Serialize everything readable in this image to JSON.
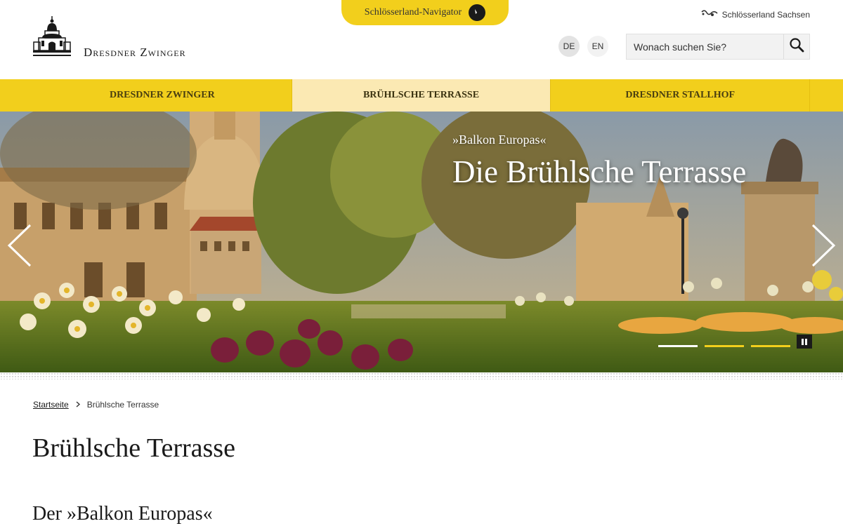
{
  "header": {
    "navigator_label": "Schlösserland-Navigator",
    "sachsen_link": "Schlösserland Sachsen",
    "logo_text": "Dresdner Zwinger",
    "lang_de": "DE",
    "lang_en": "EN",
    "search_placeholder": "Wonach suchen Sie?",
    "selected_language": "DE"
  },
  "mainnav": {
    "items": [
      {
        "label": "DRESDNER ZWINGER"
      },
      {
        "label": "BRÜHLSCHE TERRASSE",
        "active": true
      },
      {
        "label": "DRESDNER STALLHOF"
      }
    ]
  },
  "hero": {
    "subtitle": "»Balkon Europas«",
    "title": "Die Brühlsche Terrasse",
    "slide_count": 3,
    "active_slide": 1
  },
  "breadcrumb": {
    "home": "Startseite",
    "current": "Brühlsche Terrasse"
  },
  "content": {
    "page_title": "Brühlsche Terrasse",
    "section_title": "Der »Balkon Europas«"
  },
  "colors": {
    "accent_yellow": "#f2cf1c",
    "active_tab": "#fbe9b3",
    "text": "#1a1a1a"
  },
  "icons": [
    "compass-icon",
    "sachsen-logo-icon",
    "zwinger-logo-icon",
    "search-icon",
    "chevron-left-icon",
    "chevron-right-icon",
    "pause-icon"
  ]
}
